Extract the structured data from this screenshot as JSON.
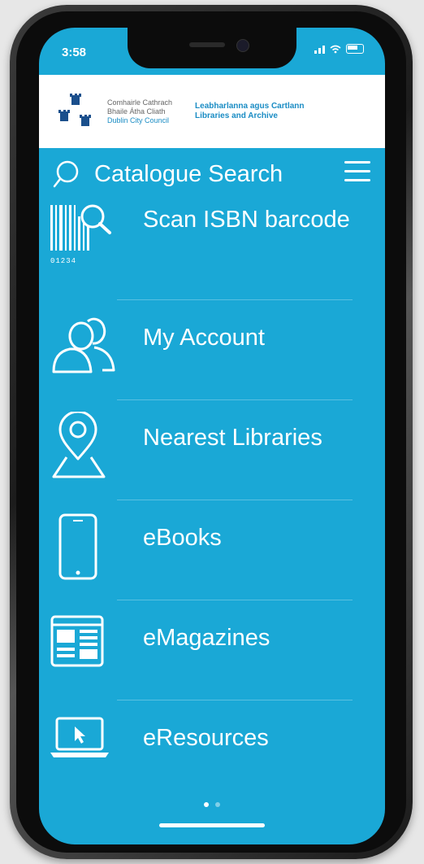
{
  "status_bar": {
    "time": "3:58"
  },
  "header": {
    "council_lines": [
      "Comhairle Cathrach",
      "Bhaile Átha Cliath",
      "Dublin City Council"
    ],
    "library_lines": [
      "Leabharlanna agus Cartlann",
      "Libraries and Archive"
    ]
  },
  "search": {
    "label": "Catalogue Search"
  },
  "menu": {
    "items": [
      {
        "label": "Scan ISBN barcode",
        "icon": "barcode-scan-icon",
        "barcode_digits": "01234"
      },
      {
        "label": "My Account",
        "icon": "users-icon"
      },
      {
        "label": "Nearest Libraries",
        "icon": "map-pin-icon"
      },
      {
        "label": "eBooks",
        "icon": "tablet-icon"
      },
      {
        "label": "eMagazines",
        "icon": "magazine-icon"
      },
      {
        "label": "eResources",
        "icon": "laptop-icon"
      }
    ]
  },
  "pagination": {
    "pages": 2,
    "current": 1
  },
  "colors": {
    "accent": "#1aa8d6",
    "brand_blue": "#1a8cc4"
  }
}
